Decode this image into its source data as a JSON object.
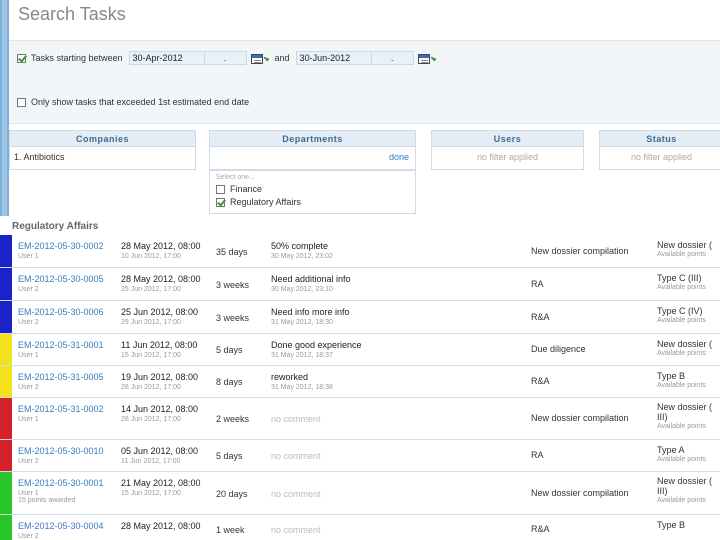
{
  "page": {
    "title": "Search Tasks"
  },
  "filters": {
    "date_range": {
      "label": "Tasks starting between",
      "start": "30-Apr-2012",
      "start_sep": ".",
      "and_label": "and",
      "end": "30-Jun-2012",
      "end_sep": "."
    },
    "exceeded": {
      "label": "Only show tasks that exceeded 1st estimated end date"
    }
  },
  "columns": {
    "companies": {
      "header": "Companies",
      "value": "1. Antibiotics"
    },
    "departments": {
      "header": "Departments",
      "value": "done"
    },
    "users": {
      "header": "Users",
      "value": "no filter applied"
    },
    "status": {
      "header": "Status",
      "value": "no filter applied"
    }
  },
  "dept_dropdown": {
    "hint": "Select one...",
    "options": [
      {
        "label": "Finance",
        "checked": false
      },
      {
        "label": "Regulatory Affairs",
        "checked": true
      }
    ]
  },
  "section": {
    "title": "Regulatory Affairs"
  },
  "colors": {
    "blue": "#1a23c8",
    "yellow": "#f2e21a",
    "red": "#d4202a",
    "green": "#27c42a",
    "link": "#3a7bbf"
  },
  "rows": [
    {
      "id": "EM-2012-05-30-0002",
      "user": "User 1",
      "date": "28 May 2012, 08:00",
      "date_sub": "10 Jun 2012, 17:00",
      "duration": "35 days",
      "note": "50% complete",
      "note_sub": "30 May 2012, 23:02",
      "dept": "New dossier compilation",
      "type": "New dossier (",
      "type_sub": "Available points",
      "marker": "blue"
    },
    {
      "id": "EM-2012-05-30-0005",
      "user": "User 2",
      "date": "28 May 2012, 08:00",
      "date_sub": "25 Jun 2012, 17:00",
      "duration": "3 weeks",
      "note": "Need additional info",
      "note_sub": "30 May 2012, 23:10",
      "dept": "RA",
      "type": "Type C (III)",
      "type_sub": "Available points",
      "marker": "blue"
    },
    {
      "id": "EM-2012-05-30-0006",
      "user": "User 2",
      "date": "25 Jun 2012, 08:00",
      "date_sub": "29 Jun 2012, 17:00",
      "duration": "3 weeks",
      "note": "Need info more info",
      "note_sub": "31 May 2012, 18:30",
      "dept": "R&A",
      "type": "Type C (IV)",
      "type_sub": "Available points",
      "marker": "blue"
    },
    {
      "id": "EM-2012-05-31-0001",
      "user": "User 1",
      "date": "11 Jun 2012, 08:00",
      "date_sub": "15 Jun 2012, 17:00",
      "duration": "5 days",
      "note": "Done good experience",
      "note_sub": "31 May 2012, 18:37",
      "dept": "Due diligence",
      "type": "New dossier (",
      "type_sub": "Available points",
      "marker": "yellow"
    },
    {
      "id": "EM-2012-05-31-0005",
      "user": "User 2",
      "date": "19 Jun 2012, 08:00",
      "date_sub": "28 Jun 2012, 17:00",
      "duration": "8 days",
      "note": "reworked",
      "note_sub": "31 May 2012, 18:38",
      "dept": "R&A",
      "type": "Type B",
      "type_sub": "Available points",
      "marker": "yellow"
    },
    {
      "id": "EM-2012-05-31-0002",
      "user": "User 1",
      "date": "14 Jun 2012, 08:00",
      "date_sub": "28 Jun 2012, 17:00",
      "duration": "2 weeks",
      "note": "no comment",
      "note_sub": "",
      "dept": "New dossier compilation",
      "type": "New dossier (",
      "type2": "III)",
      "type_sub": "Available points",
      "marker": "red"
    },
    {
      "id": "EM-2012-05-30-0010",
      "user": "User 2",
      "date": "05 Jun 2012, 08:00",
      "date_sub": "11 Jun 2012, 17:00",
      "duration": "5 days",
      "note": "no comment",
      "note_sub": "",
      "dept": "RA",
      "type": "Type A",
      "type_sub": "Available points",
      "marker": "red"
    },
    {
      "id": "EM-2012-05-30-0001",
      "user": "User 1",
      "user_extra": "15 points awarded",
      "date": "21 May 2012, 08:00",
      "date_sub": "15 Jun 2012, 17:00",
      "duration": "20 days",
      "note": "no comment",
      "note_sub": "",
      "dept": "New dossier compilation",
      "type": "New dossier (",
      "type2": "III)",
      "type_sub": "Available points",
      "marker": "green"
    },
    {
      "id": "EM-2012-05-30-0004",
      "user": "User 2",
      "date": "28 May 2012, 08:00",
      "date_sub": "",
      "duration": "1 week",
      "note": "no comment",
      "note_sub": "",
      "dept": "R&A",
      "type": "Type B",
      "type_sub": "",
      "marker": "green"
    }
  ]
}
